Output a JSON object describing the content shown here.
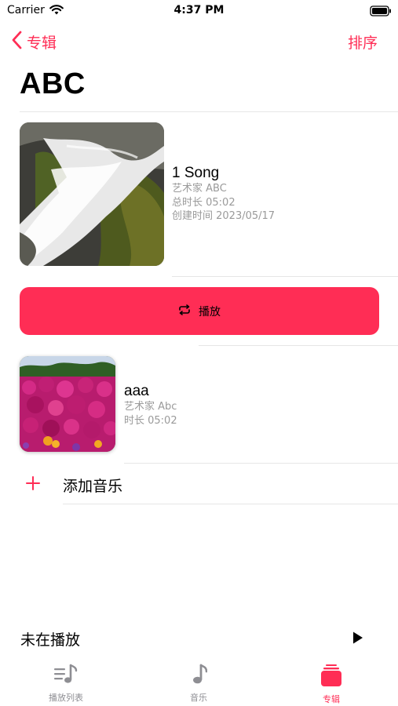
{
  "status_bar": {
    "carrier": "Carrier",
    "time": "4:37 PM"
  },
  "nav": {
    "back_label": "专辑",
    "sort_label": "排序"
  },
  "album": {
    "title": "ABC",
    "song_count": "1 Song",
    "artist": "艺术家 ABC",
    "total_duration": "总时长 05:02",
    "created": "创建时间 2023/05/17"
  },
  "play_button": {
    "label": "播放"
  },
  "tracks": [
    {
      "title": "aaa",
      "artist": "艺术家 Abc",
      "duration": "时长 05:02"
    }
  ],
  "add_music": {
    "label": "添加音乐"
  },
  "mini_player": {
    "title": "未在播放"
  },
  "tab_bar": {
    "tabs": [
      {
        "label": "播放列表",
        "icon": "playlist-icon"
      },
      {
        "label": "音乐",
        "icon": "music-note-icon"
      },
      {
        "label": "专辑",
        "icon": "album-icon",
        "selected": true
      }
    ]
  },
  "colors": {
    "accent": "#ff2d55",
    "secondary_text": "#9a9a9a",
    "inactive_tab": "#8e8e93"
  }
}
